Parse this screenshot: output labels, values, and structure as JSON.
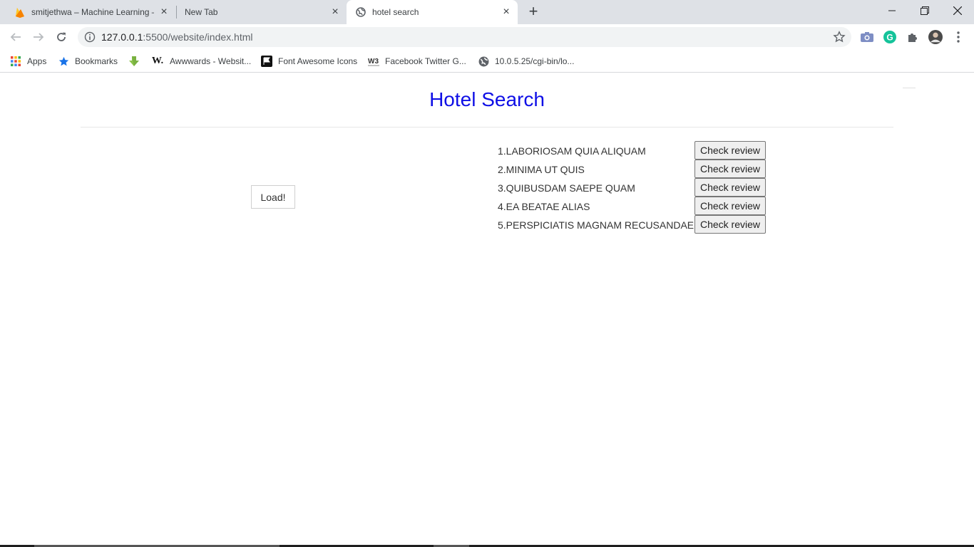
{
  "browser": {
    "tabs": [
      {
        "title": "smitjethwa – Machine Learning –",
        "icon": "firebase-icon",
        "active": false
      },
      {
        "title": "New Tab",
        "icon": "",
        "active": false
      },
      {
        "title": "hotel search",
        "icon": "globe-icon",
        "active": true
      }
    ],
    "url_host": "127.0.0.1",
    "url_path": ":5500/website/index.html",
    "bookmarks": [
      {
        "label": "Apps",
        "icon": "apps-grid-icon"
      },
      {
        "label": "Bookmarks",
        "icon": "star-icon"
      },
      {
        "label": "",
        "icon": "download-arrow-icon"
      },
      {
        "label": "Awwwards - Websit...",
        "icon": "w-logo-icon"
      },
      {
        "label": "Font Awesome Icons",
        "icon": "flag-icon"
      },
      {
        "label": "Facebook Twitter G...",
        "icon": "w3-icon"
      },
      {
        "label": "10.0.5.25/cgi-bin/lo...",
        "icon": "globe-icon"
      }
    ]
  },
  "page": {
    "title": "Hotel Search",
    "load_label": "Load!",
    "review_label": "Check review",
    "hotels": [
      {
        "name": "1.LABORIOSAM QUIA ALIQUAM"
      },
      {
        "name": "2.MINIMA UT QUIS"
      },
      {
        "name": "3.QUIBUSDAM SAEPE QUAM"
      },
      {
        "name": "4.EA BEATAE ALIAS"
      },
      {
        "name": "5.PERSPICIATIS MAGNAM RECUSANDAE"
      }
    ]
  },
  "colors": {
    "title": "#0f0fe6",
    "tabstrip": "#dee1e6",
    "omnibox": "#f1f3f4"
  }
}
